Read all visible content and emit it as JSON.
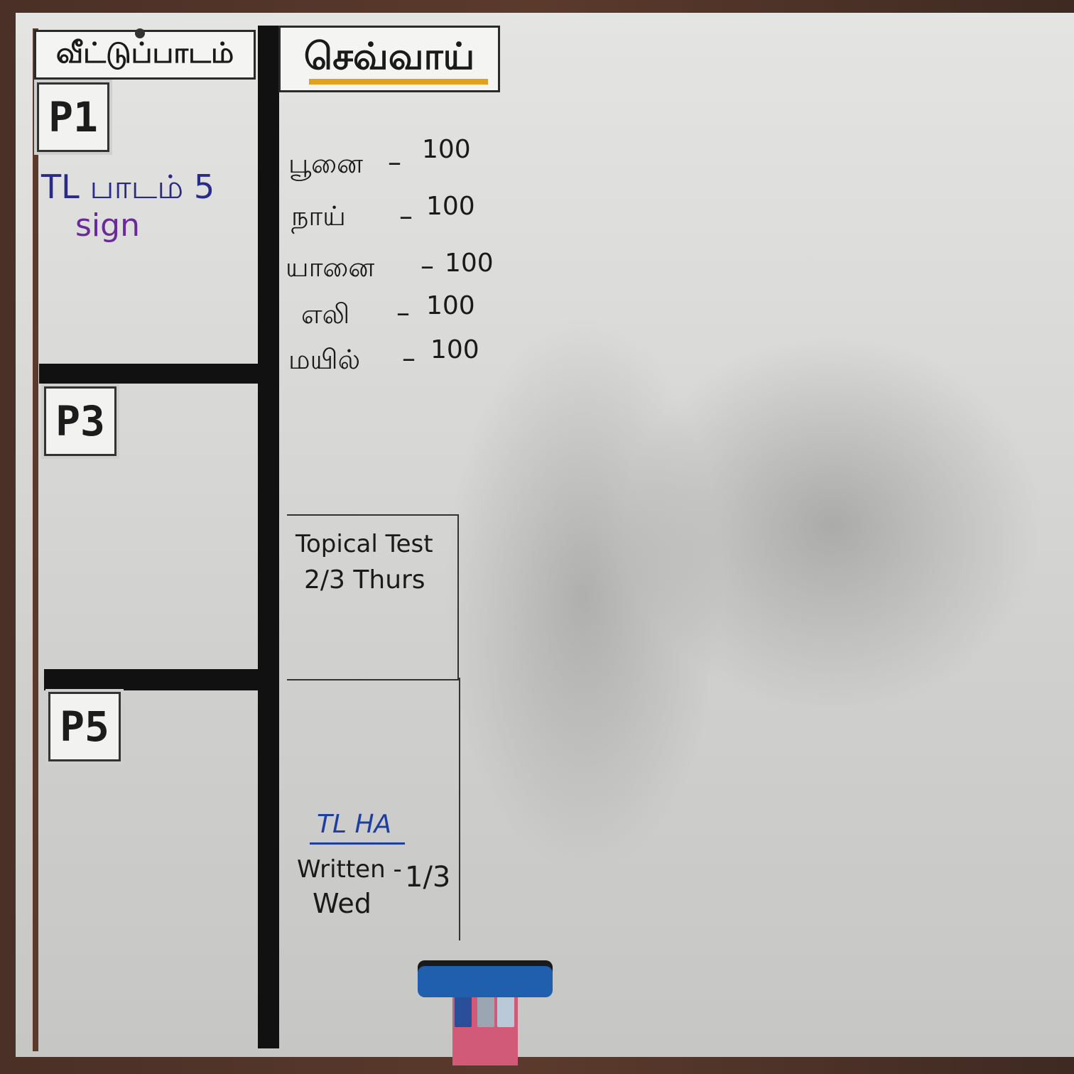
{
  "header": {
    "homework_label": "வீட்டுப்பாடம்",
    "day_label": "செவ்வாய்"
  },
  "sections": [
    {
      "label": "P1",
      "notes": [
        "TL பாடம் 5",
        "sign"
      ]
    },
    {
      "label": "P3",
      "notes": []
    },
    {
      "label": "P5",
      "notes": []
    }
  ],
  "tuesday_list": [
    {
      "word": "பூனை",
      "value": "100"
    },
    {
      "word": "நாய்",
      "value": "100"
    },
    {
      "word": "யானை",
      "value": "100"
    },
    {
      "word": "எலி",
      "value": "100"
    },
    {
      "word": "மயில்",
      "value": "100"
    }
  ],
  "topical_test": {
    "line1": "Topical Test",
    "line2": "2/3 Thurs"
  },
  "tl_ha": {
    "title": "TL HA",
    "line1": "Written -",
    "line2": "Wed",
    "date": "1/3"
  },
  "colors": {
    "accent_underline": "#e0a020",
    "p1_note_primary": "#2a2a8a",
    "p1_note_secondary": "#6a2a9a",
    "tl_ha_title": "#1f3fa0",
    "eraser": "#1f5fae",
    "marker_holder": "#d05a78"
  }
}
